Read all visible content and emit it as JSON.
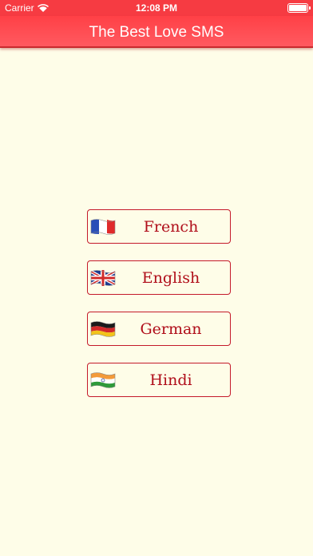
{
  "status_bar": {
    "carrier": "Carrier",
    "time": "12:08 PM"
  },
  "nav": {
    "title": "The Best Love SMS"
  },
  "languages": [
    {
      "label": "French",
      "flag_icon": "france-flag-icon"
    },
    {
      "label": "English",
      "flag_icon": "uk-flag-icon"
    },
    {
      "label": "German",
      "flag_icon": "germany-flag-icon"
    },
    {
      "label": "Hindi",
      "flag_icon": "india-flag-icon"
    }
  ],
  "colors": {
    "nav_background": "#ff4046",
    "page_background": "#fefde8",
    "button_border": "#c41a2a",
    "button_text": "#b00e1a"
  }
}
